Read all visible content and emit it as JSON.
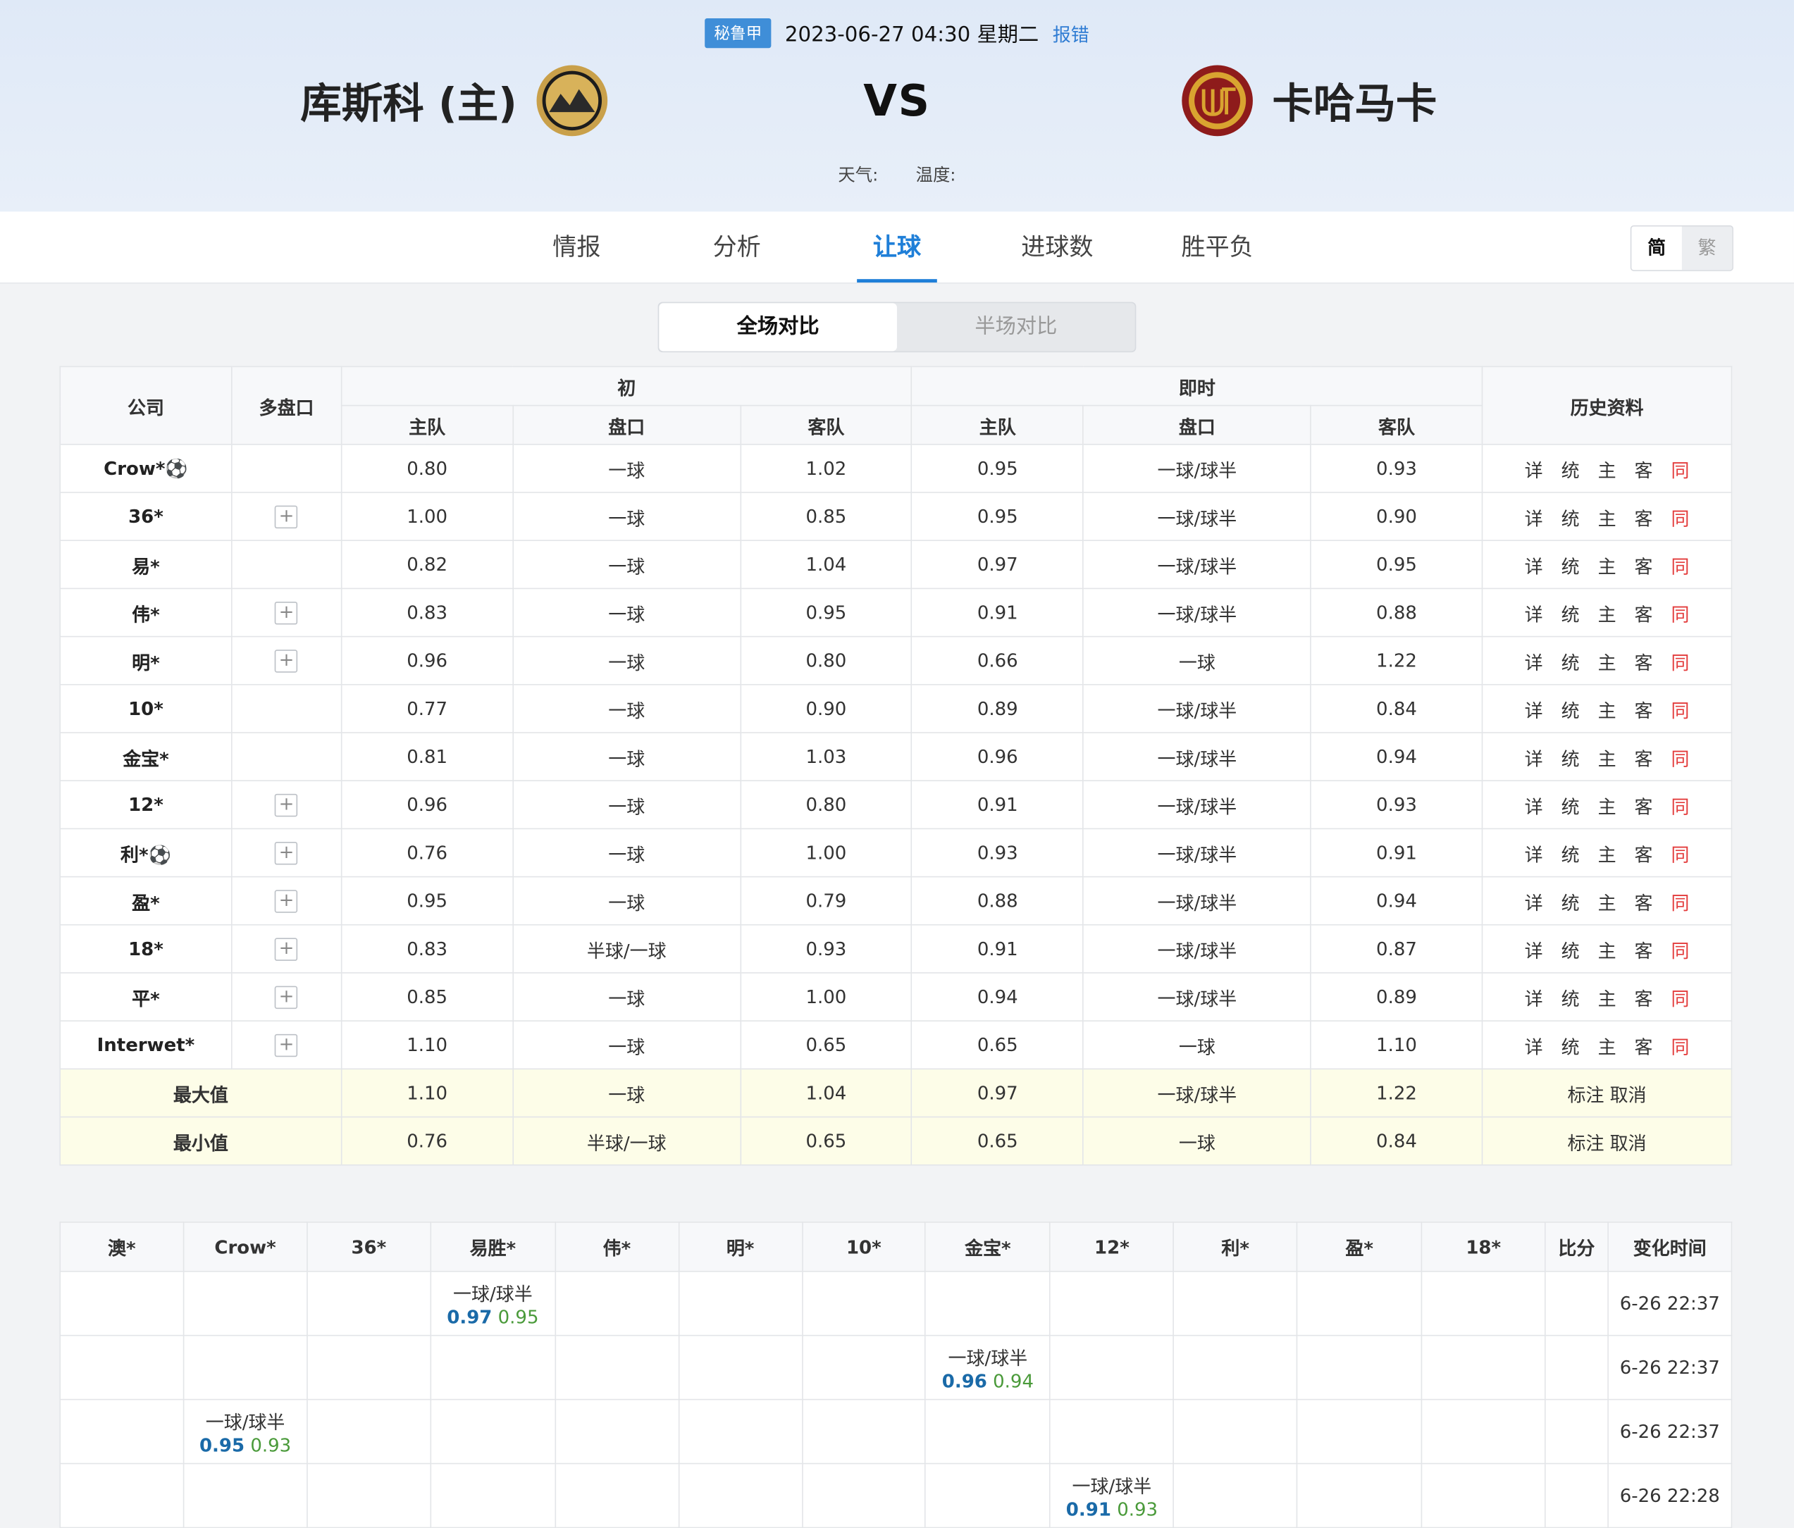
{
  "header": {
    "league": "秘鲁甲",
    "datetime": "2023-06-27 04:30 星期二",
    "report": "报错",
    "home_name": "库斯科 (主)",
    "away_name": "卡哈马卡",
    "vs": "VS",
    "weather_label": "天气:",
    "temp_label": "温度:"
  },
  "nav": {
    "tabs": [
      "情报",
      "分析",
      "让球",
      "进球数",
      "胜平负"
    ],
    "active": "让球",
    "lang_simplified": "简",
    "lang_traditional": "繁"
  },
  "segment": {
    "full": "全场对比",
    "half": "半场对比"
  },
  "odds_table": {
    "head": {
      "company": "公司",
      "multi": "多盘口",
      "initial": "初",
      "live": "即时",
      "history": "历史资料",
      "home": "主队",
      "line": "盘口",
      "away": "客队"
    },
    "rows": [
      {
        "company": "Crow*⚽",
        "plus": false,
        "i": [
          "0.80",
          "一球",
          "1.02"
        ],
        "l": [
          "0.95",
          "一球/球半",
          "0.93"
        ]
      },
      {
        "company": "36*",
        "plus": true,
        "i": [
          "1.00",
          "一球",
          "0.85"
        ],
        "l": [
          "0.95",
          "一球/球半",
          "0.90"
        ]
      },
      {
        "company": "易*",
        "plus": false,
        "i": [
          "0.82",
          "一球",
          "1.04"
        ],
        "l": [
          "0.97",
          "一球/球半",
          "0.95"
        ]
      },
      {
        "company": "伟*",
        "plus": true,
        "i": [
          "0.83",
          "一球",
          "0.95"
        ],
        "l": [
          "0.91",
          "一球/球半",
          "0.88"
        ]
      },
      {
        "company": "明*",
        "plus": true,
        "i": [
          "0.96",
          "一球",
          "0.80"
        ],
        "l": [
          "0.66",
          "一球",
          "1.22"
        ]
      },
      {
        "company": "10*",
        "plus": false,
        "i": [
          "0.77",
          "一球",
          "0.90"
        ],
        "l": [
          "0.89",
          "一球/球半",
          "0.84"
        ]
      },
      {
        "company": "金宝*",
        "plus": false,
        "i": [
          "0.81",
          "一球",
          "1.03"
        ],
        "l": [
          "0.96",
          "一球/球半",
          "0.94"
        ]
      },
      {
        "company": "12*",
        "plus": true,
        "i": [
          "0.96",
          "一球",
          "0.80"
        ],
        "l": [
          "0.91",
          "一球/球半",
          "0.93"
        ]
      },
      {
        "company": "利*⚽",
        "plus": true,
        "i": [
          "0.76",
          "一球",
          "1.00"
        ],
        "l": [
          "0.93",
          "一球/球半",
          "0.91"
        ]
      },
      {
        "company": "盈*",
        "plus": true,
        "i": [
          "0.95",
          "一球",
          "0.79"
        ],
        "l": [
          "0.88",
          "一球/球半",
          "0.94"
        ]
      },
      {
        "company": "18*",
        "plus": true,
        "i": [
          "0.83",
          "半球/一球",
          "0.93"
        ],
        "l": [
          "0.91",
          "一球/球半",
          "0.87"
        ]
      },
      {
        "company": "平*",
        "plus": true,
        "i": [
          "0.85",
          "一球",
          "1.00"
        ],
        "l": [
          "0.94",
          "一球/球半",
          "0.89"
        ]
      },
      {
        "company": "Interwet*",
        "plus": true,
        "i": [
          "1.10",
          "一球",
          "0.65"
        ],
        "l": [
          "0.65",
          "一球",
          "1.10"
        ]
      }
    ],
    "links": [
      "详",
      "统",
      "主",
      "客",
      "同"
    ],
    "max": {
      "label": "最大值",
      "vals": [
        "1.10",
        "一球",
        "1.04",
        "0.97",
        "一球/球半",
        "1.22"
      ],
      "action": "标注 取消"
    },
    "min": {
      "label": "最小值",
      "vals": [
        "0.76",
        "半球/一球",
        "0.65",
        "0.65",
        "一球",
        "0.84"
      ],
      "action": "标注 取消"
    }
  },
  "change_table": {
    "headers": [
      "澳*",
      "Crow*",
      "36*",
      "易胜*",
      "伟*",
      "明*",
      "10*",
      "金宝*",
      "12*",
      "利*",
      "盈*",
      "18*",
      "比分",
      "变化时间"
    ],
    "rows": [
      {
        "col": 3,
        "line": "一球/球半",
        "h": "0.97",
        "a": "0.95",
        "time": "6-26 22:37"
      },
      {
        "col": 7,
        "line": "一球/球半",
        "h": "0.96",
        "a": "0.94",
        "time": "6-26 22:37"
      },
      {
        "col": 1,
        "line": "一球/球半",
        "h": "0.95",
        "a": "0.93",
        "time": "6-26 22:37"
      },
      {
        "col": 8,
        "line": "一球/球半",
        "h": "0.91",
        "a": "0.93",
        "time": "6-26 22:28"
      }
    ]
  },
  "colors": {
    "accent": "#1f7fd8",
    "league_bg": "#3f8ed8",
    "link_red": "#e33b3b",
    "stat_bg": "#fdfde8",
    "home_odds": "#1a6aa8",
    "away_odds": "#4a9a3a"
  }
}
